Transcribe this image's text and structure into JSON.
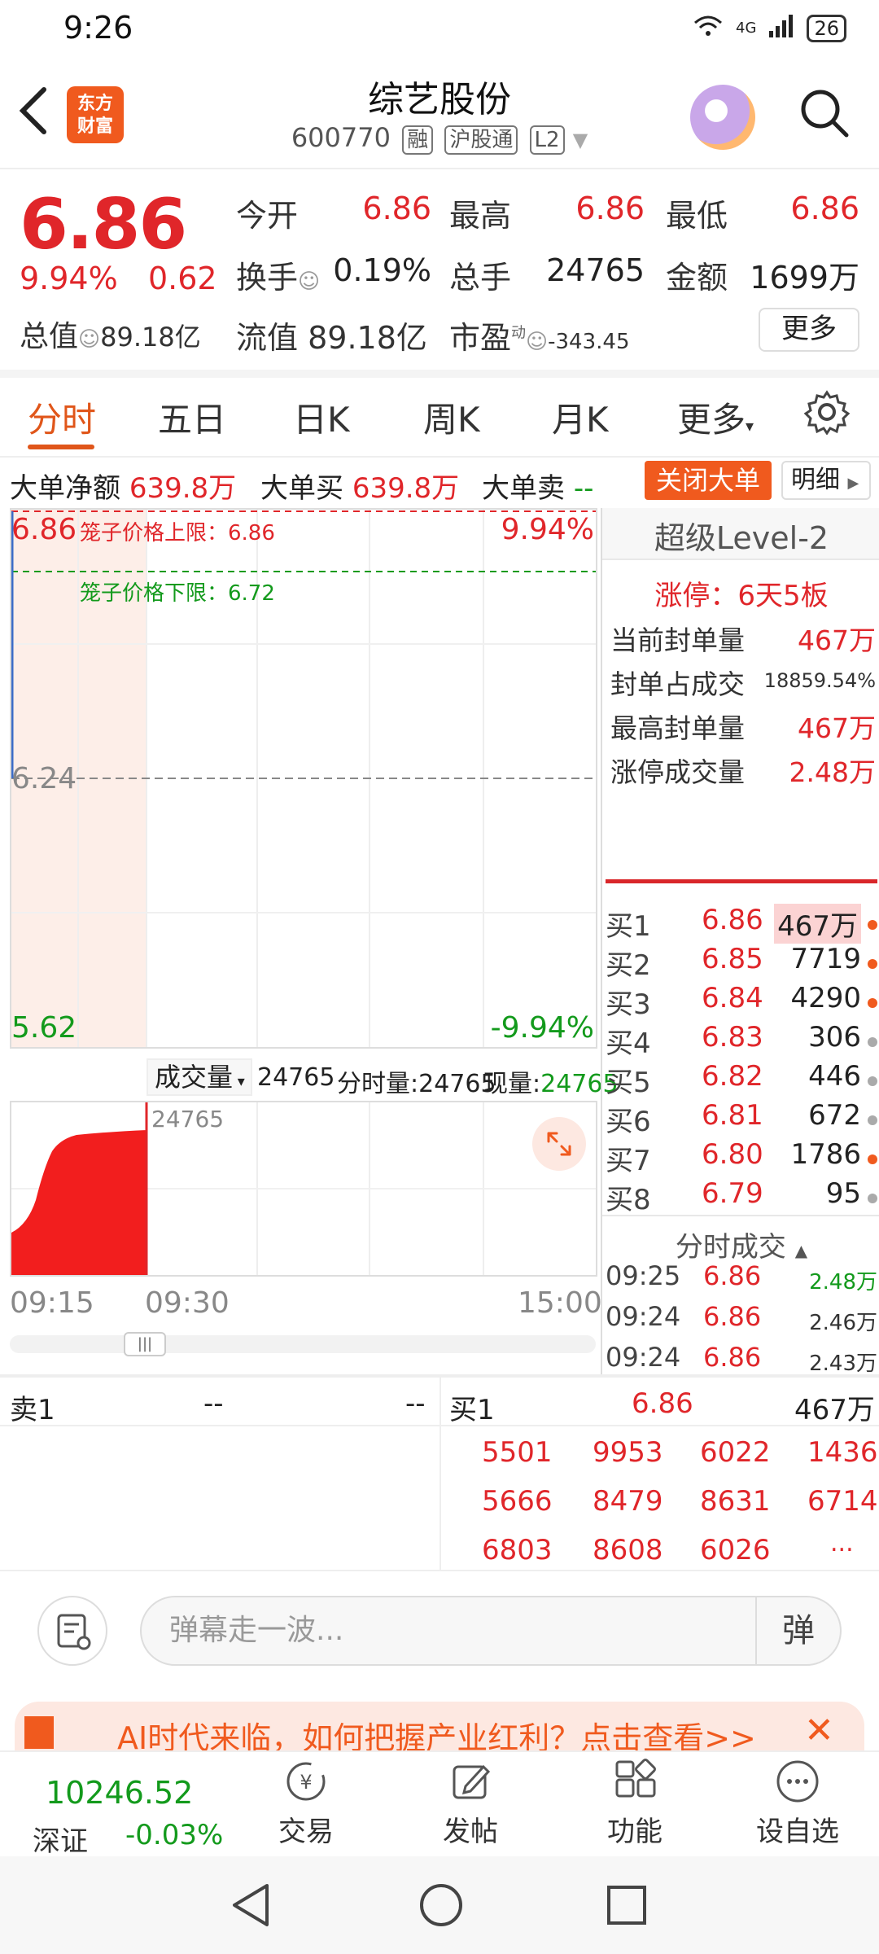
{
  "status_bar": {
    "time": "9:26",
    "network": "4G",
    "battery": "26"
  },
  "header": {
    "title": "综艺股份",
    "code": "600770",
    "tags": [
      "融",
      "沪股通",
      "L2"
    ],
    "logo_text_1": "东方",
    "logo_text_2": "财富"
  },
  "quote": {
    "price": "6.86",
    "change_pct": "9.94%",
    "change": "0.62",
    "total_value_label": "总值",
    "total_value": "89.18亿",
    "open_label": "今开",
    "open": "6.86",
    "high_label": "最高",
    "high": "6.86",
    "low_label": "最低",
    "low": "6.86",
    "turnover_label": "换手",
    "turnover": "0.19%",
    "volume_label": "总手",
    "volume": "24765",
    "amount_label": "金额",
    "amount": "1699万",
    "float_label": "流值",
    "float_value": "89.18亿",
    "pe_label": "市盈",
    "pe_sup": "动",
    "pe": "-343.45",
    "more": "更多"
  },
  "tabs": [
    {
      "label": "分时",
      "active": true
    },
    {
      "label": "五日"
    },
    {
      "label": "日K"
    },
    {
      "label": "周K"
    },
    {
      "label": "月K"
    },
    {
      "label": "更多"
    }
  ],
  "big_order": {
    "net_label": "大单净额",
    "net": "639.8万",
    "buy_label": "大单买",
    "buy": "639.8万",
    "sell_label": "大单卖",
    "sell": "--",
    "close_btn": "关闭大单",
    "detail_btn": "明细"
  },
  "chart": {
    "top_price": "6.86",
    "mid_price": "6.24",
    "low_price": "5.62",
    "top_pct": "9.94%",
    "low_pct": "-9.94%",
    "upper_limit": "笼子价格上限：6.86",
    "lower_limit": "笼子价格下限：6.72",
    "volume_selector": "成交量",
    "volume_total": "24765",
    "min_volume": "分时量:24765",
    "cur_volume_label": "现量:",
    "cur_volume": "24765",
    "vol_axis_max": "24765",
    "time_start": "09:15",
    "time_open": "09:30",
    "time_end": "15:00"
  },
  "level2": {
    "title": "超级Level-2",
    "limit_up": "涨停：6天5板",
    "rows": [
      {
        "label": "当前封单量",
        "value": "467万"
      },
      {
        "label": "封单占成交",
        "value": "18859.54%"
      },
      {
        "label": "最高封单量",
        "value": "467万"
      },
      {
        "label": "涨停成交量",
        "value": "2.48万"
      }
    ],
    "book": [
      {
        "label": "买1",
        "price": "6.86",
        "qty": "467万",
        "dot": "#f05a1e"
      },
      {
        "label": "买2",
        "price": "6.85",
        "qty": "7719",
        "dot": "#f05a1e"
      },
      {
        "label": "买3",
        "price": "6.84",
        "qty": "4290",
        "dot": "#f05a1e"
      },
      {
        "label": "买4",
        "price": "6.83",
        "qty": "306",
        "dot": "#aaaaaa"
      },
      {
        "label": "买5",
        "price": "6.82",
        "qty": "446",
        "dot": "#aaaaaa"
      },
      {
        "label": "买6",
        "price": "6.81",
        "qty": "672",
        "dot": "#aaaaaa"
      },
      {
        "label": "买7",
        "price": "6.80",
        "qty": "1786",
        "dot": "#f05a1e"
      },
      {
        "label": "买8",
        "price": "6.79",
        "qty": "95",
        "dot": "#aaaaaa"
      }
    ],
    "trades_title": "分时成交",
    "trades": [
      {
        "time": "09:25",
        "price": "6.86",
        "qty": "2.48万"
      },
      {
        "time": "09:24",
        "price": "6.86",
        "qty": "2.46万"
      },
      {
        "time": "09:24",
        "price": "6.86",
        "qty": "2.43万"
      }
    ]
  },
  "queue": {
    "sell_label": "卖1",
    "sell_price": "--",
    "sell_qty": "--",
    "buy_label": "买1",
    "buy_price": "6.86",
    "buy_qty": "467万",
    "orders": [
      [
        "5501",
        "9953",
        "6022",
        "1436"
      ],
      [
        "5666",
        "8479",
        "8631",
        "6714"
      ],
      [
        "6803",
        "8608",
        "6026",
        "..."
      ]
    ]
  },
  "comment": {
    "placeholder": "弹幕走一波...",
    "dan": "弹"
  },
  "ad": {
    "text": "AI时代来临，如何把握产业红利？点击查看>>"
  },
  "bottom_nav": {
    "index_value": "10246.52",
    "index_name": "深证",
    "index_change": "-0.03%",
    "items": [
      "交易",
      "发帖",
      "功能",
      "设自选"
    ]
  },
  "colors": {
    "up": "#e0262a",
    "down": "#139a1c",
    "accent": "#f05a1e"
  }
}
